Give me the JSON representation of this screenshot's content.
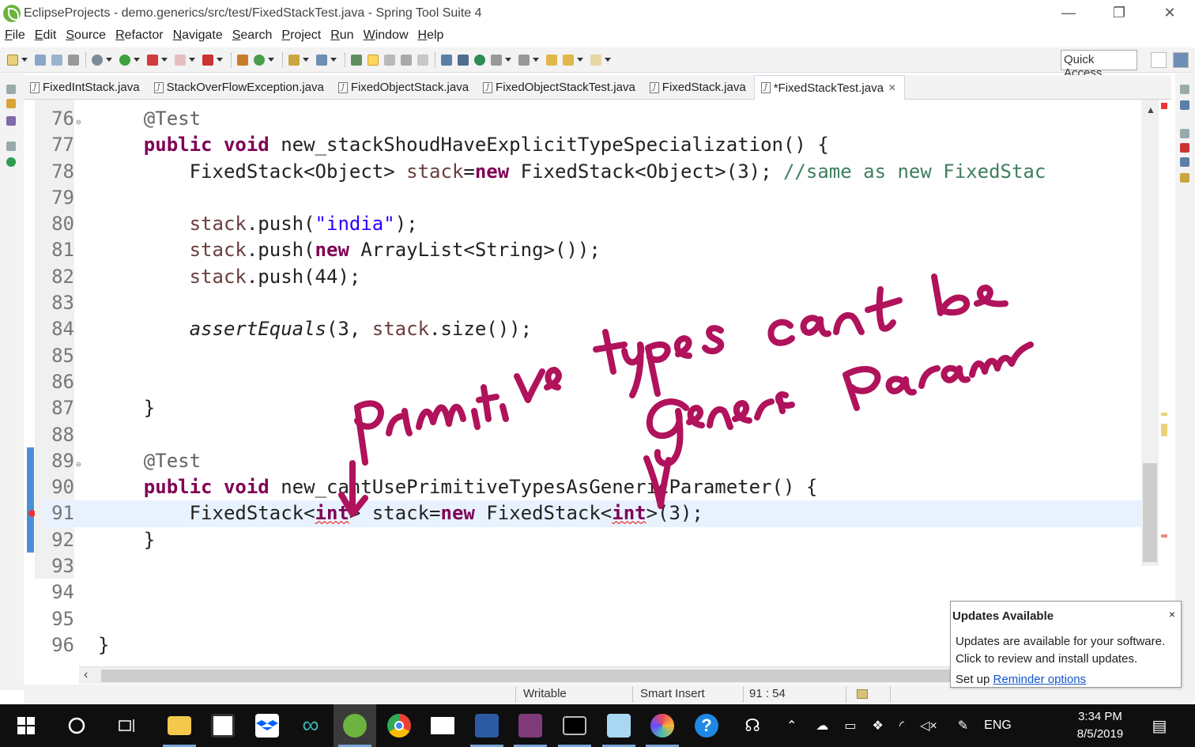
{
  "window": {
    "title": "EclipseProjects - demo.generics/src/test/FixedStackTest.java - Spring Tool Suite 4",
    "minimize": "—",
    "restore": "❐",
    "close": "✕"
  },
  "menu": [
    "File",
    "Edit",
    "Source",
    "Refactor",
    "Navigate",
    "Search",
    "Project",
    "Run",
    "Window",
    "Help"
  ],
  "toolbar": {
    "quick_access": "Quick Access"
  },
  "tabs": [
    {
      "label": "FixedIntStack.java",
      "active": false
    },
    {
      "label": "StackOverFlowException.java",
      "active": false
    },
    {
      "label": "FixedObjectStack.java",
      "active": false
    },
    {
      "label": "FixedObjectStackTest.java",
      "active": false
    },
    {
      "label": "FixedStack.java",
      "active": false
    },
    {
      "label": "*FixedStackTest.java",
      "active": true,
      "close": "✕"
    }
  ],
  "editor": {
    "lines": [
      {
        "n": "76",
        "text": "    @Test"
      },
      {
        "n": "77",
        "text": "    public void new_stackShoudHaveExplicitTypeSpecialization() {"
      },
      {
        "n": "78",
        "text": "        FixedStack<Object> stack=new FixedStack<Object>(3); //same as new FixedStac"
      },
      {
        "n": "79",
        "text": ""
      },
      {
        "n": "80",
        "text": "        stack.push(\"india\");"
      },
      {
        "n": "81",
        "text": "        stack.push(new ArrayList<String>());"
      },
      {
        "n": "82",
        "text": "        stack.push(44);"
      },
      {
        "n": "83",
        "text": ""
      },
      {
        "n": "84",
        "text": "        assertEquals(3, stack.size());"
      },
      {
        "n": "85",
        "text": ""
      },
      {
        "n": "86",
        "text": ""
      },
      {
        "n": "87",
        "text": "    }"
      },
      {
        "n": "88",
        "text": ""
      },
      {
        "n": "89",
        "text": "    @Test"
      },
      {
        "n": "90",
        "text": "    public void new_cantUsePrimitiveTypesAsGenericParameter() {"
      },
      {
        "n": "91",
        "text": "        FixedStack<int> stack=new FixedStack<int>(3);"
      },
      {
        "n": "92",
        "text": "    }"
      },
      {
        "n": "93",
        "text": ""
      },
      {
        "n": "94",
        "text": ""
      },
      {
        "n": "95",
        "text": ""
      },
      {
        "n": "96",
        "text": "}"
      }
    ],
    "current_line": "91",
    "error_line": "91"
  },
  "annotation": {
    "line1": "primitive types cant be",
    "line2": "Generic Param"
  },
  "status": {
    "writable": "Writable",
    "insert_mode": "Smart Insert",
    "position": "91 : 54"
  },
  "popup": {
    "title": "Updates Available",
    "close": "×",
    "body_line1": "Updates are available for your software.",
    "body_line2": "Click to review and install updates.",
    "footer_prefix": "Set up",
    "footer_link": "Reminder options"
  },
  "taskbar": {
    "language": "ENG",
    "time": "3:34 PM",
    "date": "8/5/2019"
  },
  "colors": {
    "keyword": "#7f0055",
    "string": "#2a00ff",
    "comment": "#3f7f5f",
    "ink": "#b0125b",
    "taskbar": "#0f0f0f"
  }
}
